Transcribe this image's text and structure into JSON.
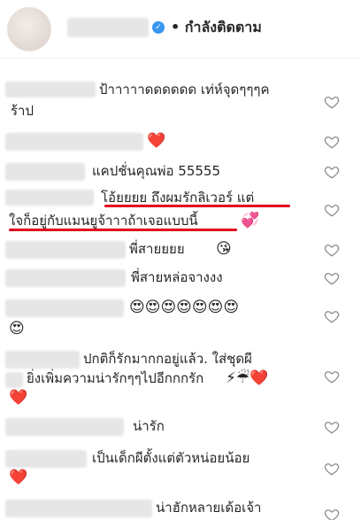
{
  "header": {
    "follow_label": "• กำลังติดตาม"
  },
  "icons": {
    "verified": "verified-badge-icon",
    "like": "heart-outline-icon"
  },
  "colors": {
    "verified": "#3897f0",
    "underline": "#e0001b",
    "heart_red": "#e0001b"
  },
  "comments": [
    {
      "line1": "ป้าาาาาดดดดดด เท่ห์จุดๆๆๆค",
      "line2": "ร้าป"
    },
    {
      "emoji": "❤️"
    },
    {
      "text": "แคปชั่นคุณพ่อ 55555"
    },
    {
      "line1": "โอ้ยยยย ถึงผมรักลิเวอร์ แต่",
      "line2": "ใจก็อยู่กับแมนยูจ้าาาถ้าเจอแบบนี้",
      "emoji": "💞"
    },
    {
      "text": "พี่สายยยย",
      "emoji": "😘"
    },
    {
      "text": "พี่สายหล่อจางงง"
    },
    {
      "emoji_line1": "😍😍😍😍😍😍😍",
      "emoji_line2": "😍"
    },
    {
      "line1": "ปกติก็รักมากกอยู่แล้ว. ใส่ชุดผี",
      "line2": "ยิ่งเพิ่มความน่ารักๆๆไปอีกกกรัก",
      "emoji_line2": "⚡☔❤️",
      "emoji_line3": "❤️"
    },
    {
      "text": "น่ารัก"
    },
    {
      "text": "เป็นเด็กผีตั้งแต่ตัวหน่อยน้อย",
      "emoji": "❤️"
    },
    {
      "text": "น่าฮักหลายเด้อเจ้า"
    }
  ]
}
